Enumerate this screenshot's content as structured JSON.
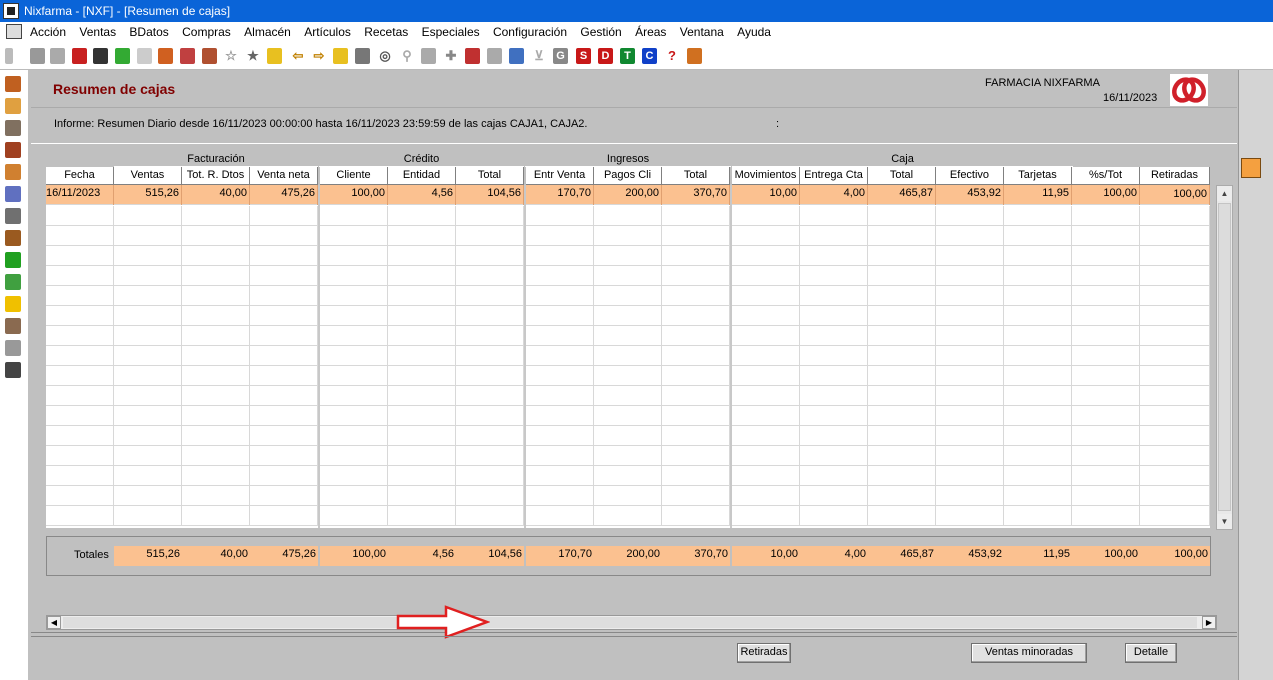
{
  "window": {
    "title": "Nixfarma - [NXF] - [Resumen de cajas]"
  },
  "menu": [
    "Acción",
    "Ventas",
    "BDatos",
    "Compras",
    "Almacén",
    "Artículos",
    "Recetas",
    "Especiales",
    "Configuración",
    "Gestión",
    "Áreas",
    "Ventana",
    "Ayuda"
  ],
  "toolbar": {
    "letters": [
      "G",
      "S",
      "D",
      "T",
      "C"
    ],
    "help": "?"
  },
  "header": {
    "title": "Resumen de cajas",
    "pharmacy": "FARMACIA NIXFARMA",
    "date": "16/11/2023"
  },
  "informe": {
    "label": "Informe:",
    "text": "Resumen Diario desde 16/11/2023 00:00:00 hasta 16/11/2023 23:59:59 de las cajas CAJA1, CAJA2.",
    "colon": ":"
  },
  "groups": [
    "Facturación",
    "Crédito",
    "Ingresos",
    "Caja"
  ],
  "columns": [
    "Fecha",
    "Ventas",
    "Tot. R. Dtos",
    "Venta neta",
    "Cliente",
    "Entidad",
    "Total",
    "Entr Venta",
    "Pagos Cli",
    "Total",
    "Movimientos",
    "Entrega Cta",
    "Total",
    "Efectivo",
    "Tarjetas",
    "%s/Tot",
    "Retiradas"
  ],
  "rows": [
    [
      "16/11/2023",
      "515,26",
      "40,00",
      "475,26",
      "100,00",
      "4,56",
      "104,56",
      "170,70",
      "200,00",
      "370,70",
      "10,00",
      "4,00",
      "465,87",
      "453,92",
      "11,95",
      "100,00",
      "100,00"
    ]
  ],
  "totals": {
    "label": "Totales",
    "values": [
      "515,26",
      "40,00",
      "475,26",
      "100,00",
      "4,56",
      "104,56",
      "170,70",
      "200,00",
      "370,70",
      "10,00",
      "4,00",
      "465,87",
      "453,92",
      "11,95",
      "100,00",
      "100,00"
    ]
  },
  "buttons": {
    "retiradas": "Retiradas",
    "ventas_minoradas": "Ventas minoradas",
    "detalle": "Detalle"
  },
  "colors": {
    "titlebar": "#0a64d8",
    "title_text": "#800000",
    "selected_row": "#fbc190",
    "arrow": "#e02020"
  }
}
